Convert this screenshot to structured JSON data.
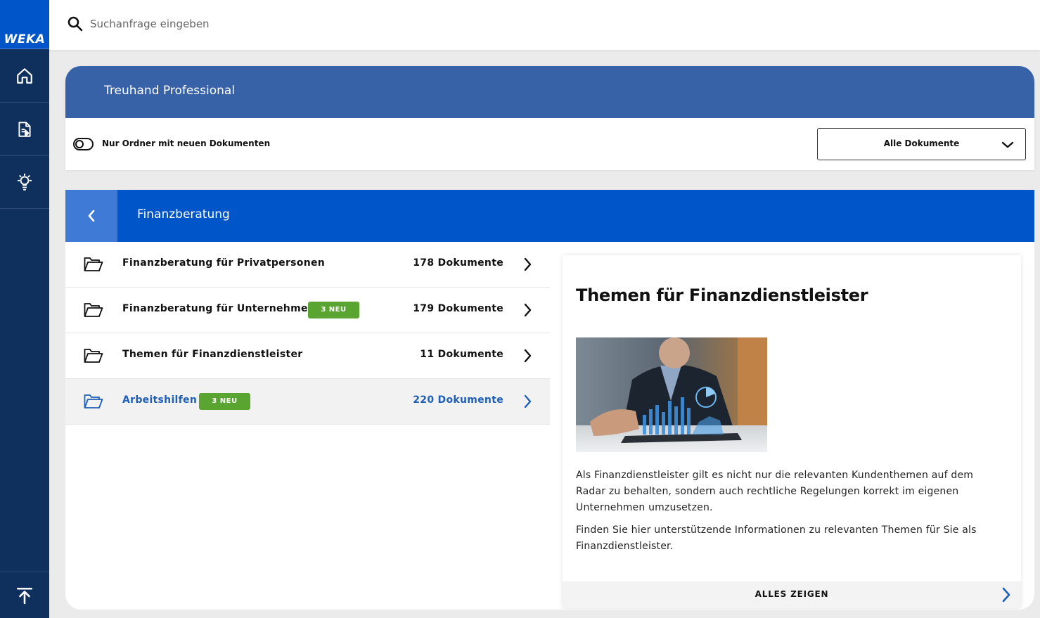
{
  "brand": {
    "logo_text": "WEKA"
  },
  "sidebar": {
    "items": [
      {
        "name": "home",
        "icon": "home-icon"
      },
      {
        "name": "documents",
        "icon": "documents-icon"
      },
      {
        "name": "ideas",
        "icon": "lightbulb-icon"
      }
    ],
    "bottom_icon": "scroll-top-icon"
  },
  "search": {
    "placeholder": "Suchanfrage eingeben",
    "value": ""
  },
  "product": {
    "title": "Treuhand Professional",
    "toggle_label": "Nur Ordner mit neuen Dokumenten",
    "toggle_on": false,
    "filter_selected": "Alle Dokumente"
  },
  "folder": {
    "title": "Finanzberatung",
    "items": [
      {
        "title": "Finanzberatung für Privatpersonen",
        "badge": "",
        "count": "178 Dokumente",
        "active": false
      },
      {
        "title": "Finanzberatung für Unternehmen",
        "badge": "3 NEU",
        "count": "179 Dokumente",
        "active": false
      },
      {
        "title": "Themen für Finanzdienstleister",
        "badge": "",
        "count": "11 Dokumente",
        "active": false
      },
      {
        "title": "Arbeitshilfen",
        "badge": "3 NEU",
        "count": "220 Dokumente",
        "active": true
      }
    ]
  },
  "info": {
    "title": "Themen für Finanzdienstleister",
    "paragraph_1": "Als Finanzdienstleister gilt es nicht nur die relevanten Kundenthemen auf dem Radar zu behalten, sondern auch rechtliche Regelungen korrekt im eigenen Unternehmen umzusetzen.",
    "paragraph_2": "Finden Sie hier unterstützende Informationen zu relevanten Themen für Sie als Finanzdienstleister.",
    "show_all_label": "ALLES ZEIGEN"
  },
  "colors": {
    "sidebar": "#0f2f5c",
    "logo_bg": "#0055c8",
    "product_header": "#3762a8",
    "folder_header": "#0055c8",
    "badge_green": "#5aa531",
    "active_blue": "#1f5fb8"
  }
}
